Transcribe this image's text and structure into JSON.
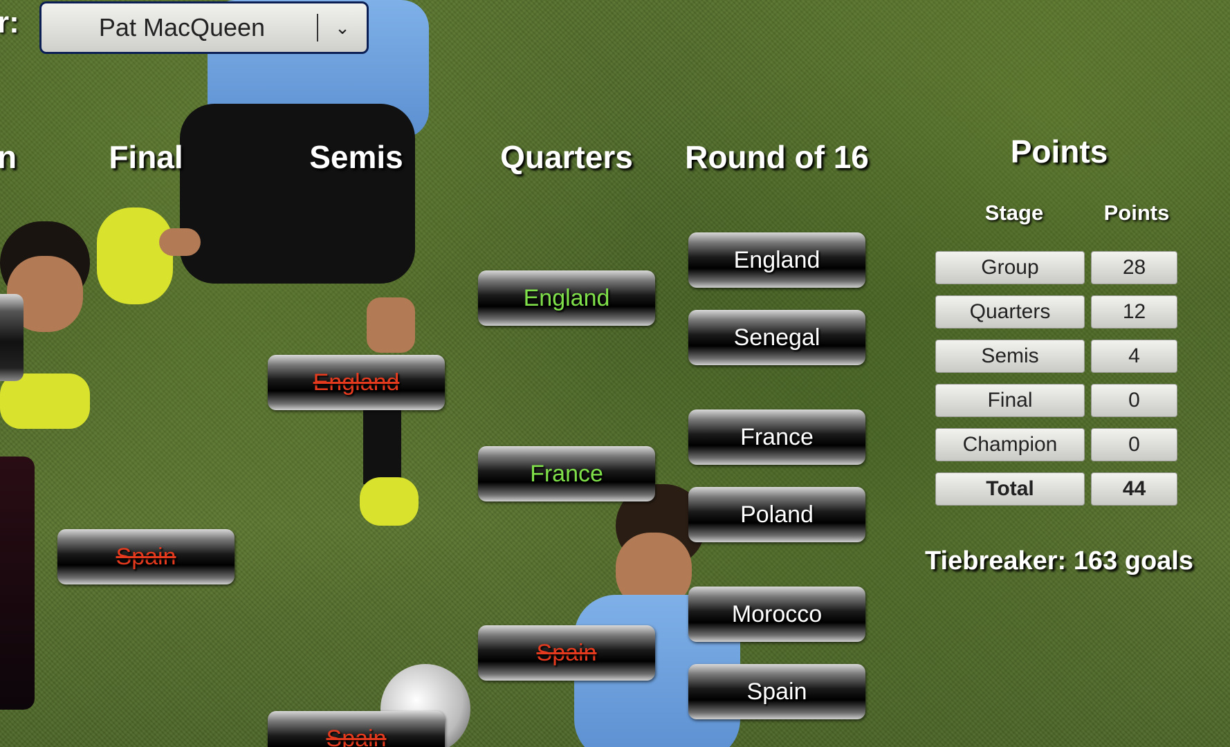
{
  "player_select": {
    "label": "r:",
    "selected": "Pat MacQueen"
  },
  "columns": {
    "champion_partial": "n",
    "final": "Final",
    "semis": "Semis",
    "quarters": "Quarters",
    "round_of_16": "Round of 16"
  },
  "round_of_16": [
    "England",
    "Senegal",
    "France",
    "Poland",
    "Morocco",
    "Spain"
  ],
  "quarters": [
    {
      "team": "England",
      "status": "correct"
    },
    {
      "team": "France",
      "status": "correct"
    },
    {
      "team": "Spain",
      "status": "eliminated"
    }
  ],
  "semis": [
    {
      "team": "England",
      "status": "eliminated"
    },
    {
      "team": "Spain",
      "status": "eliminated"
    }
  ],
  "final": [
    {
      "team": "Spain",
      "status": "eliminated"
    }
  ],
  "points": {
    "title": "Points",
    "header_stage": "Stage",
    "header_points": "Points",
    "rows": [
      {
        "stage": "Group",
        "points": "28"
      },
      {
        "stage": "Quarters",
        "points": "12"
      },
      {
        "stage": "Semis",
        "points": "4"
      },
      {
        "stage": "Final",
        "points": "0"
      },
      {
        "stage": "Champion",
        "points": "0"
      },
      {
        "stage": "Total",
        "points": "44"
      }
    ]
  },
  "tiebreaker": "Tiebreaker: 163 goals",
  "colors": {
    "correct": "#7fe04a",
    "eliminated": "#e53a1e",
    "select_border": "#0b1f55"
  }
}
